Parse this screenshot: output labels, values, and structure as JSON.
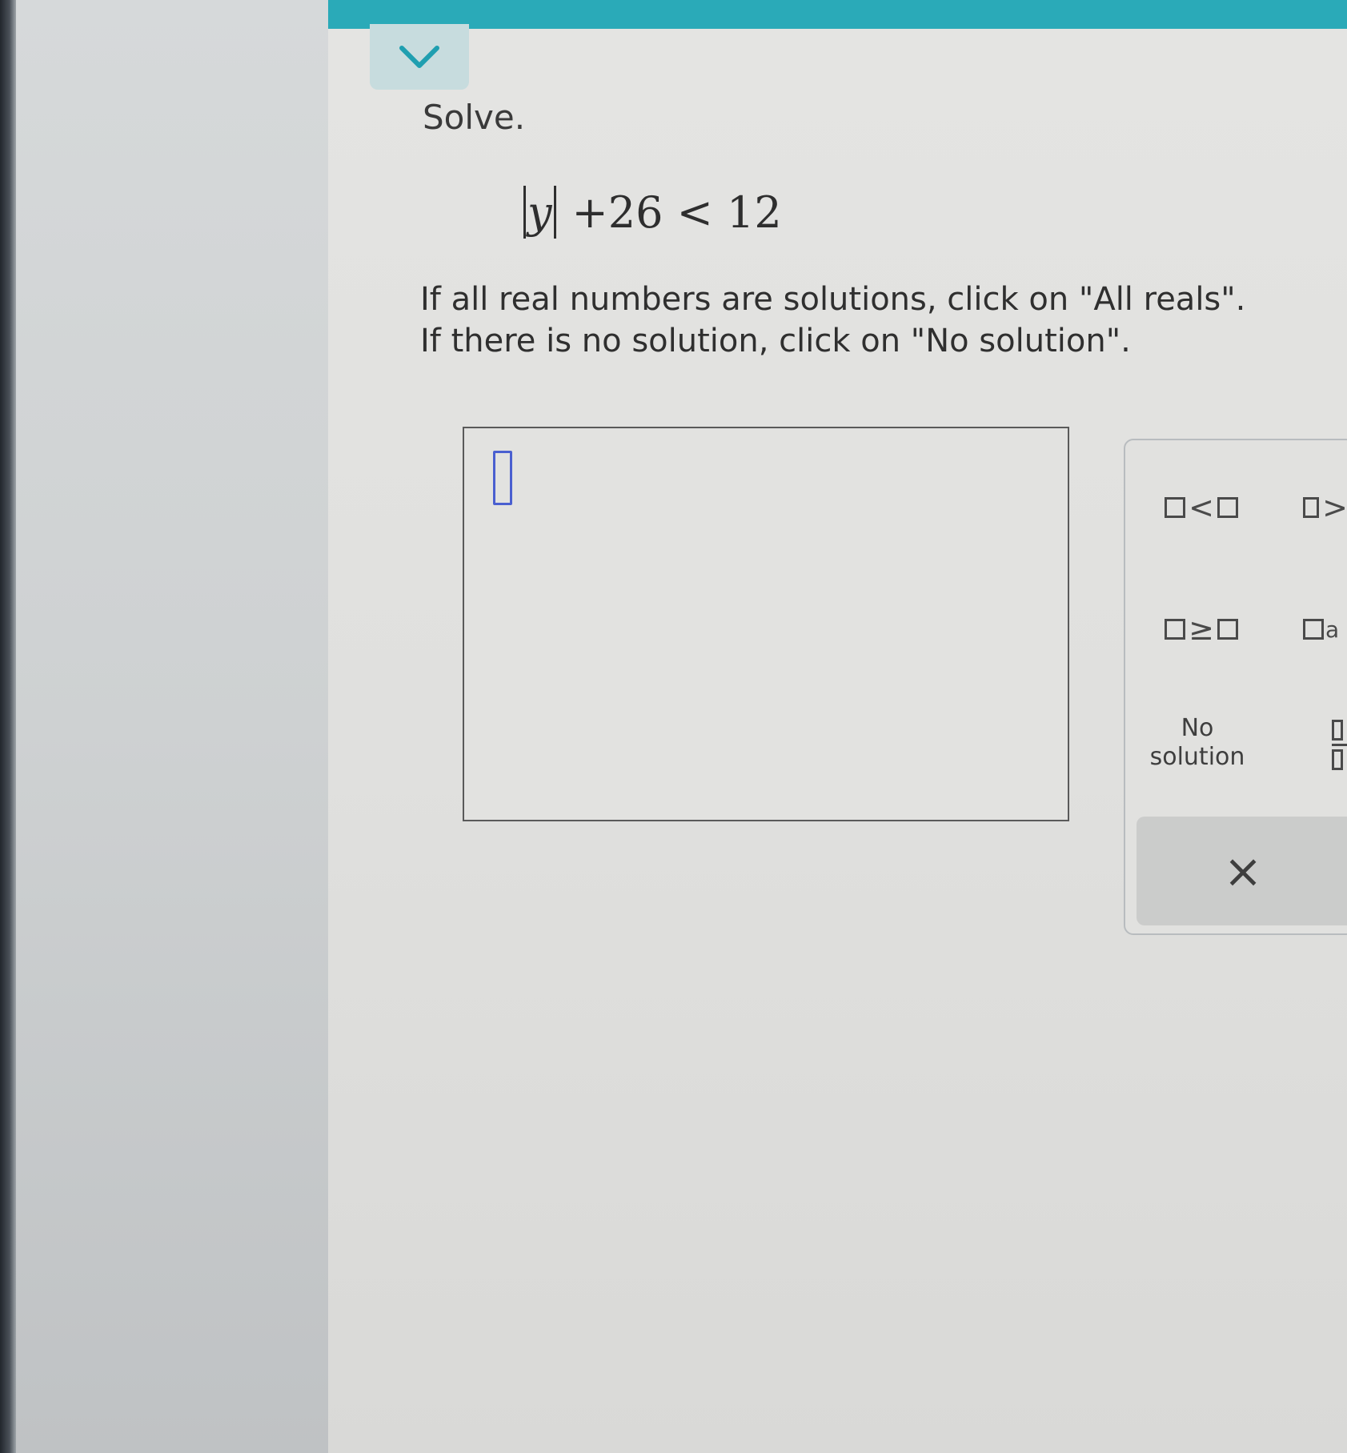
{
  "problem": {
    "label": "Solve.",
    "equation": {
      "variable": "y",
      "rest": "+26 < 12"
    },
    "instructions": [
      "If all real numbers are solutions, click on \"All reals\".",
      "If there is no solution, click on \"No solution\"."
    ]
  },
  "answer": {
    "value": ""
  },
  "keypad": {
    "less_than": "<",
    "greater_than_partial": ">",
    "greater_equal": "≥",
    "and_partial": "a",
    "no_solution": [
      "No",
      "solution"
    ],
    "clear": "×"
  },
  "colors": {
    "top_bar": "#2aaab8",
    "cursor": "#4a5fd0"
  }
}
